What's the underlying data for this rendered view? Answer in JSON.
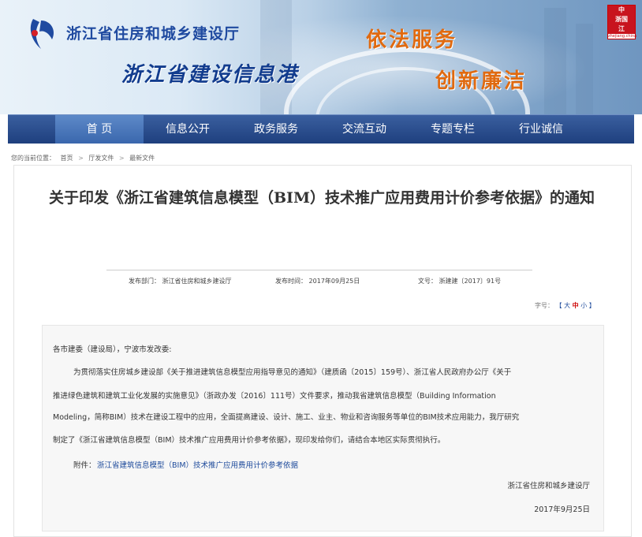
{
  "header": {
    "org_name": "浙江省住房和城乡建设厅",
    "site_title": "浙江省建设信息港",
    "slogan_1": "依法服务",
    "slogan_2": "创新廉洁",
    "badge_line1": "中",
    "badge_line2": "浙国",
    "badge_line3": "江",
    "badge_sub": "zhejiang.china"
  },
  "nav": {
    "items": [
      {
        "label": "首 页",
        "active": true
      },
      {
        "label": "信息公开"
      },
      {
        "label": "政务服务"
      },
      {
        "label": "交流互动"
      },
      {
        "label": "专题专栏"
      },
      {
        "label": "行业诚信"
      }
    ]
  },
  "breadcrumb": {
    "prefix": "您的当前位置：",
    "items": [
      "首页",
      "厅发文件",
      "最新文件"
    ],
    "separator": ">"
  },
  "article": {
    "title": "关于印发《浙江省建筑信息模型（BIM）技术推广应用费用计价参考依据》的通知",
    "publisher_label": "发布部门：",
    "publisher": "浙江省住房和城乡建设厅",
    "date_label": "发布时间：",
    "date": "2017年09月25日",
    "doc_no_label": "文号：",
    "doc_no": "浙建建〔2017〕91号",
    "font_size": {
      "label": "字号：",
      "open": "【",
      "large": "大",
      "medium": "中",
      "small": "小",
      "close": "】"
    },
    "salutation": "各市建委（建设局），宁波市发改委:",
    "body_lines": [
      "为贯彻落实住房城乡建设部《关于推进建筑信息模型应用指导意见的通知》（建质函〔2015〕159号）、浙江省人民政府办公厅《关于",
      "推进绿色建筑和建筑工业化发展的实施意见》（浙政办发〔2016〕111号）文件要求，推动我省建筑信息模型（Building Information",
      "Modeling，简称BIM）技术在建设工程中的应用，全面提高建设、设计、施工、业主、物业和咨询服务等单位的BIM技术应用能力，我厅研究",
      "制定了《浙江省建筑信息模型（BIM）技术推广应用费用计价参考依据》，现印发给你们，请结合本地区实际贯彻执行。"
    ],
    "attachment_label": "附件：",
    "attachment_link": "浙江省建筑信息模型（BIM）技术推广应用费用计价参考依据",
    "signature": "浙江省住房和城乡建设厅",
    "sign_date": "2017年9月25日"
  },
  "colors": {
    "nav_bg": "#1e3f7e",
    "nav_active": "#3a67ad",
    "slogan": "#e06a10",
    "link": "#1d4a9b"
  }
}
